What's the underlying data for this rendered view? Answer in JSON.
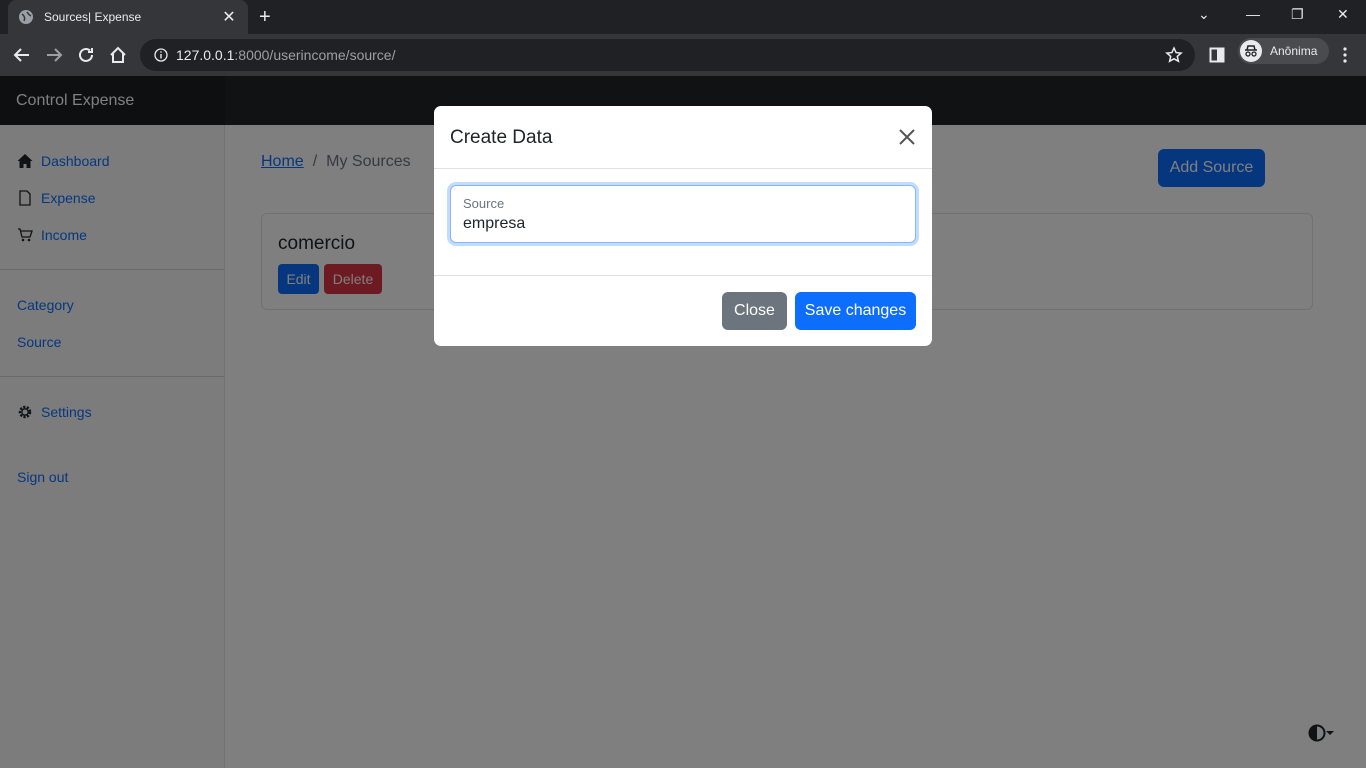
{
  "browser": {
    "tab_title": "Sources| Expense",
    "url_host": "127.0.0.1",
    "url_rest": ":8000/userincome/source/",
    "profile_label": "Anônima"
  },
  "app": {
    "brand": "Control Expense"
  },
  "sidebar": {
    "items": [
      {
        "label": "Dashboard",
        "icon": "house-icon"
      },
      {
        "label": "Expense",
        "icon": "file-icon"
      },
      {
        "label": "Income",
        "icon": "cart-icon"
      },
      {
        "label": "Category"
      },
      {
        "label": "Source"
      },
      {
        "label": "Settings",
        "icon": "gear-icon"
      },
      {
        "label": "Sign out"
      }
    ]
  },
  "breadcrumb": {
    "home": "Home",
    "separator": "/",
    "current": "My Sources"
  },
  "actions": {
    "add_source": "Add Source"
  },
  "sources": [
    {
      "name": "comercio",
      "edit_label": "Edit",
      "delete_label": "Delete"
    }
  ],
  "modal": {
    "title": "Create Data",
    "field_label": "Source",
    "field_value": "empresa",
    "close_label": "Close",
    "save_label": "Save changes"
  },
  "colors": {
    "primary": "#0d6efd",
    "danger": "#dc3545",
    "secondary": "#6c757d",
    "navbar": "#212529"
  }
}
